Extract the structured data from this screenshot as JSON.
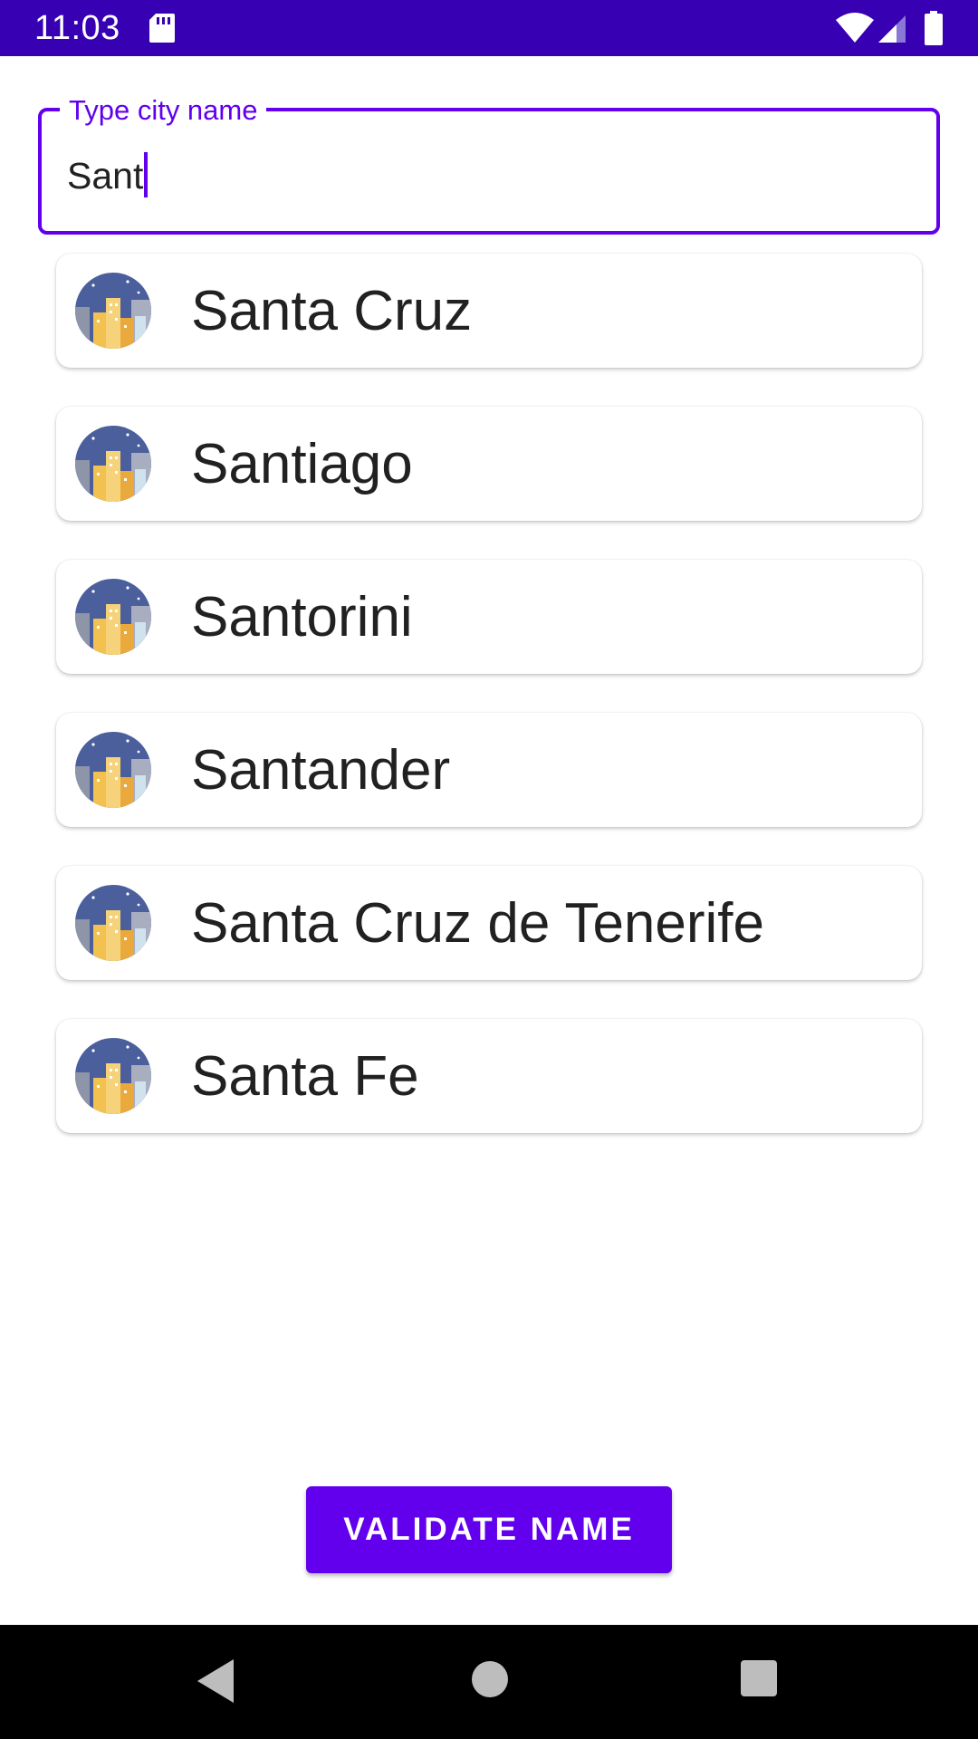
{
  "status_bar": {
    "time": "11:03",
    "icons": [
      "sd-card-icon",
      "wifi-icon",
      "signal-icon",
      "battery-icon"
    ],
    "background": "#3700B3"
  },
  "city_field": {
    "label": "Type city name",
    "value": "Sant",
    "accent_color": "#6200EE"
  },
  "suggestions": [
    {
      "name": "Santa Cruz",
      "icon": "city-night-icon"
    },
    {
      "name": "Santiago",
      "icon": "city-night-icon"
    },
    {
      "name": "Santorini",
      "icon": "city-night-icon"
    },
    {
      "name": "Santander",
      "icon": "city-night-icon"
    },
    {
      "name": "Santa Cruz de Tenerife",
      "icon": "city-night-icon"
    },
    {
      "name": "Santa Fe",
      "icon": "city-night-icon"
    }
  ],
  "validate_button": {
    "label": "VALIDATE NAME",
    "color": "#6200EE"
  },
  "nav_bar": {
    "icons": [
      "back-icon",
      "home-icon",
      "recents-icon"
    ]
  }
}
